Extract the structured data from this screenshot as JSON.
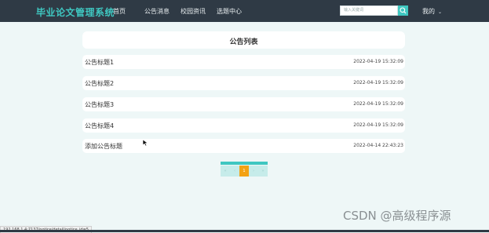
{
  "header": {
    "brand": "毕业论文管理系统",
    "nav": [
      "首页",
      "公告消息",
      "校园资讯",
      "选题中心"
    ],
    "search_placeholder": "输入关键词",
    "user_menu": "我的",
    "user_menu_caret": "⌄"
  },
  "notice_list": {
    "title": "公告列表",
    "items": [
      {
        "title": "公告标题1",
        "time": "2022-04-19 15:32:09"
      },
      {
        "title": "公告标题2",
        "time": "2022-04-19 15:32:09"
      },
      {
        "title": "公告标题3",
        "time": "2022-04-19 15:32:09"
      },
      {
        "title": "公告标题4",
        "time": "2022-04-19 15:32:09"
      },
      {
        "title": "添加公告标题",
        "time": "2022-04-14 22:43:23"
      }
    ]
  },
  "pagination": {
    "first": "«",
    "prev": "‹",
    "current": "1",
    "next": "›",
    "last": "»"
  },
  "statusbar": {
    "url": "192.168.1.4:7137/notice/detail/notice_id=5"
  },
  "watermark": "CSDN @高级程序源",
  "colors": {
    "topbar": "#2f3a45",
    "accent": "#3fc7c1",
    "page_bg": "#eef7f7",
    "active_page": "#f3a214"
  }
}
